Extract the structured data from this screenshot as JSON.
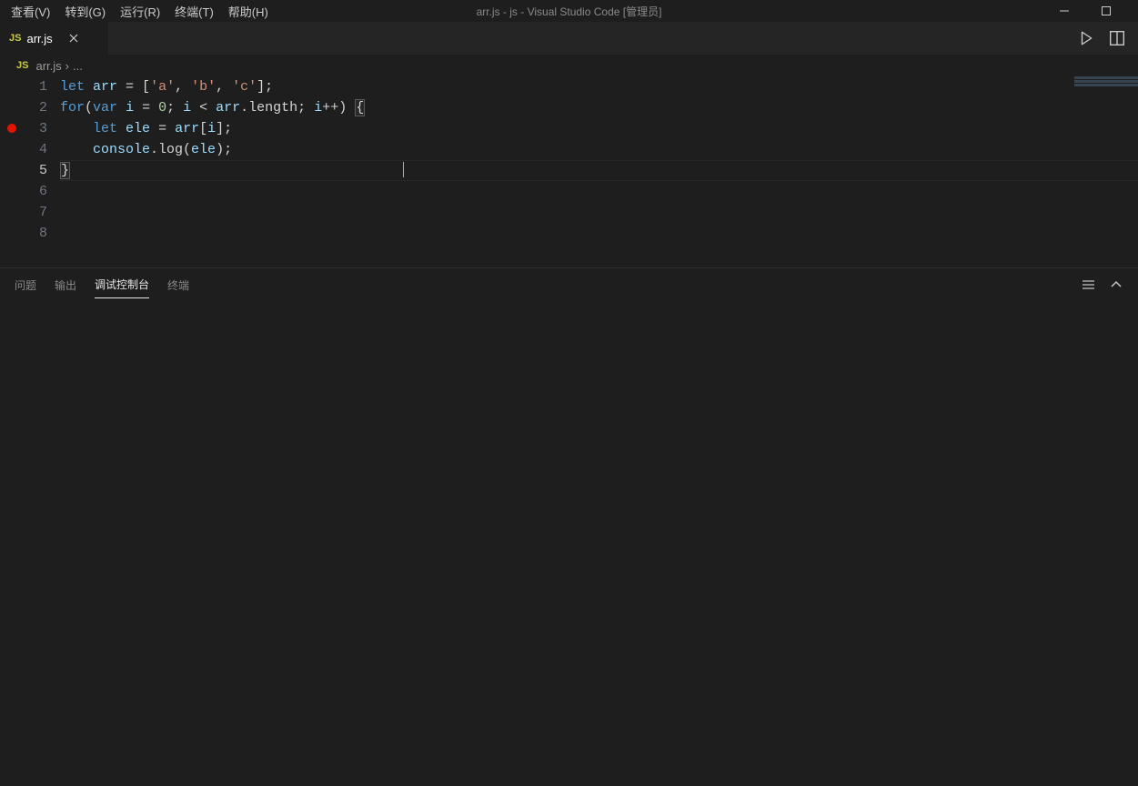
{
  "menubar": {
    "items": [
      "查看(V)",
      "转到(G)",
      "运行(R)",
      "终端(T)",
      "帮助(H)"
    ],
    "title": "arr.js - js - Visual Studio Code [管理员]"
  },
  "tabs": {
    "open": [
      {
        "label": "arr.js",
        "icon": "JS"
      }
    ]
  },
  "breadcrumbs": {
    "icon": "JS",
    "file": "arr.js",
    "sep": "›",
    "more": "..."
  },
  "editor": {
    "lineNumbers": [
      "1",
      "2",
      "3",
      "4",
      "5",
      "6",
      "7",
      "8"
    ],
    "breakpointLine": 3,
    "currentLine": 5,
    "code": {
      "l1": {
        "indent": "",
        "kw1": "let",
        "sp1": " ",
        "id1": "arr",
        "p1": " = [",
        "s1": "'a'",
        "p2": ", ",
        "s2": "'b'",
        "p3": ", ",
        "s3": "'c'",
        "p4": "];"
      },
      "l2": {
        "indent": "",
        "kw1": "for",
        "p1": "(",
        "kw2": "var",
        "sp1": " ",
        "id1": "i",
        "p2": " = ",
        "n1": "0",
        "p3": "; ",
        "id2": "i",
        "p4": " < ",
        "id3": "arr",
        "p5": ".length; ",
        "id4": "i",
        "p6": "++) ",
        "br": "{"
      },
      "l3": {
        "indent": "    ",
        "kw1": "let",
        "sp1": " ",
        "id1": "ele",
        "p1": " = ",
        "id2": "arr",
        "p2": "[",
        "id3": "i",
        "p3": "];"
      },
      "l4": {
        "indent": "    ",
        "id1": "console",
        "p1": ".log(",
        "id2": "ele",
        "p2": ");"
      },
      "l5": {
        "indent": "",
        "br": "}"
      }
    }
  },
  "panel": {
    "tabs": [
      "问题",
      "输出",
      "调试控制台",
      "终端"
    ],
    "activeIndex": 2
  }
}
